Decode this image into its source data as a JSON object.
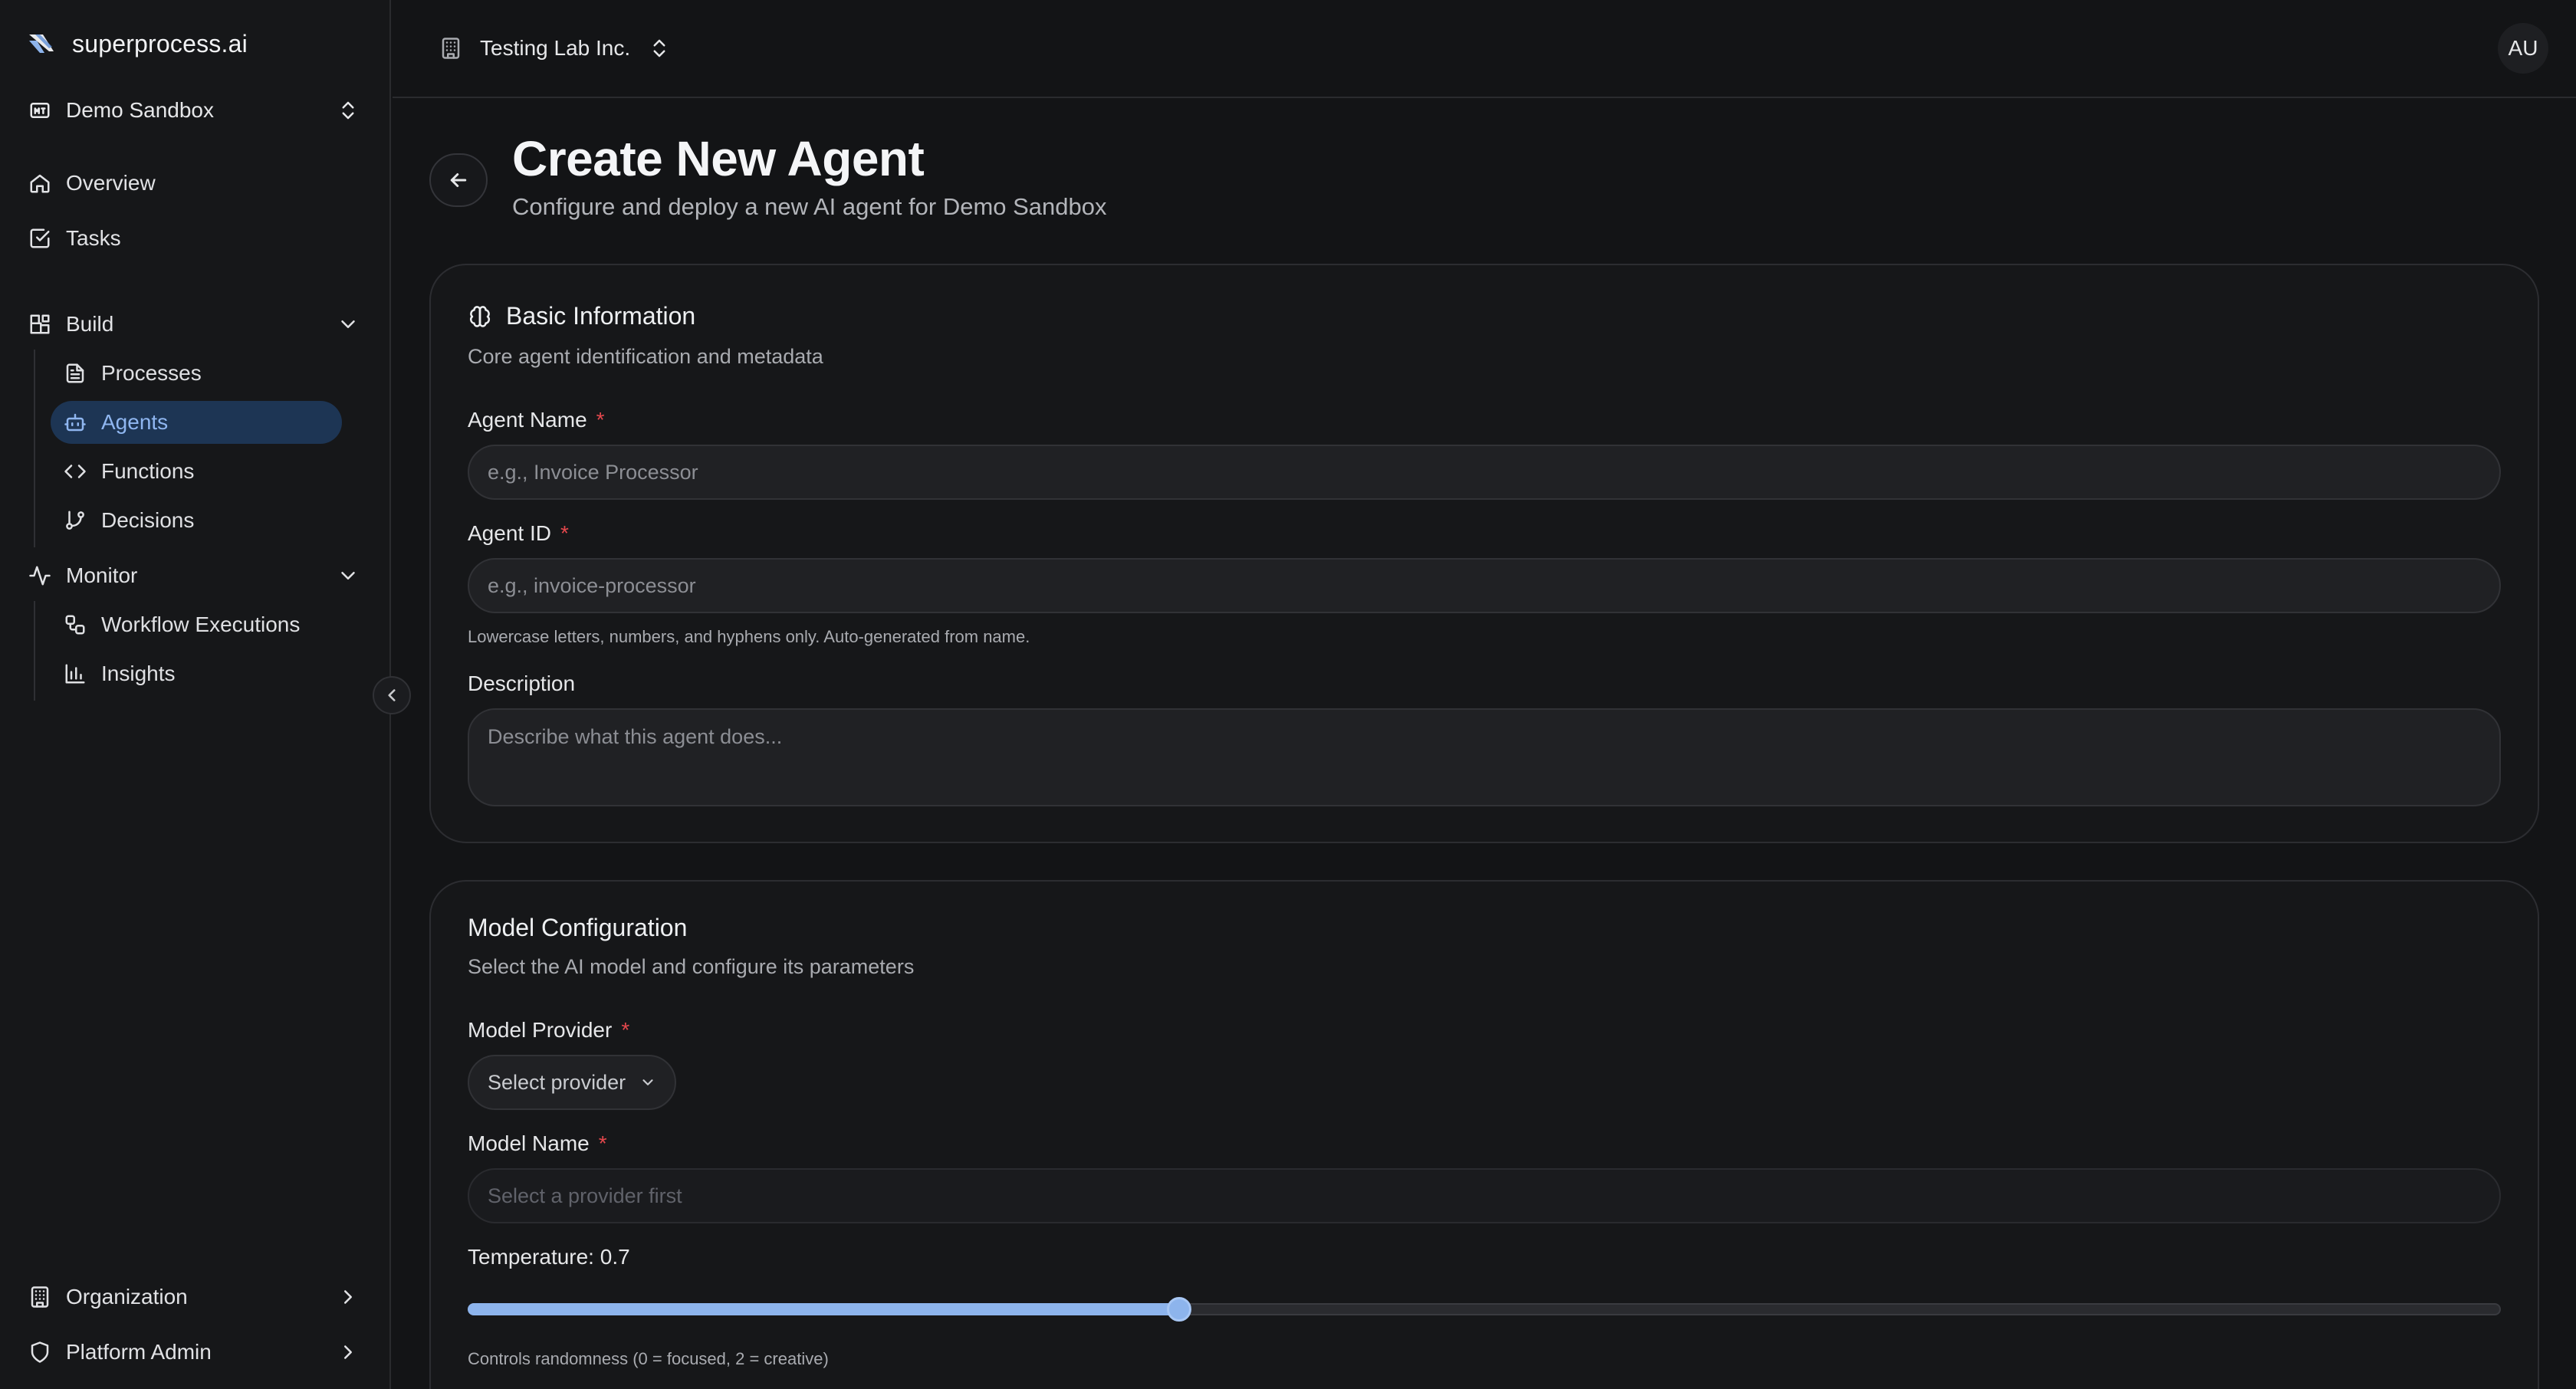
{
  "brand": {
    "name": "superprocess.ai"
  },
  "workspace": {
    "name": "Demo Sandbox"
  },
  "nav": {
    "overview": "Overview",
    "tasks": "Tasks",
    "build": {
      "label": "Build",
      "items": [
        {
          "label": "Processes"
        },
        {
          "label": "Agents",
          "active": true
        },
        {
          "label": "Functions"
        },
        {
          "label": "Decisions"
        }
      ]
    },
    "monitor": {
      "label": "Monitor",
      "items": [
        {
          "label": "Workflow Executions"
        },
        {
          "label": "Insights"
        }
      ]
    },
    "organization": "Organization",
    "platform_admin": "Platform Admin"
  },
  "topbar": {
    "org_name": "Testing Lab Inc.",
    "avatar_initials": "AU"
  },
  "page": {
    "title": "Create New Agent",
    "subtitle": "Configure and deploy a new AI agent for Demo Sandbox"
  },
  "basic_info": {
    "title": "Basic Information",
    "description": "Core agent identification and metadata",
    "agent_name": {
      "label": "Agent Name",
      "required_mark": "*",
      "placeholder": "e.g., Invoice Processor",
      "value": ""
    },
    "agent_id": {
      "label": "Agent ID",
      "required_mark": "*",
      "placeholder": "e.g., invoice-processor",
      "value": "",
      "hint": "Lowercase letters, numbers, and hyphens only. Auto-generated from name."
    },
    "description_field": {
      "label": "Description",
      "placeholder": "Describe what this agent does...",
      "value": ""
    }
  },
  "model_config": {
    "title": "Model Configuration",
    "description": "Select the AI model and configure its parameters",
    "provider": {
      "label": "Model Provider",
      "required_mark": "*",
      "selected": "Select provider"
    },
    "model_name": {
      "label": "Model Name",
      "required_mark": "*",
      "placeholder": "Select a provider first",
      "disabled": true
    },
    "temperature": {
      "label": "Temperature: 0.7",
      "value": 0.7,
      "min": 0,
      "max": 2,
      "hint": "Controls randomness (0 = focused, 2 = creative)"
    }
  },
  "colors": {
    "background": "#131416",
    "sidebar": "#161719",
    "accent": "#8db4ec",
    "active_nav_bg": "#1d3554",
    "required": "#e5484d"
  }
}
